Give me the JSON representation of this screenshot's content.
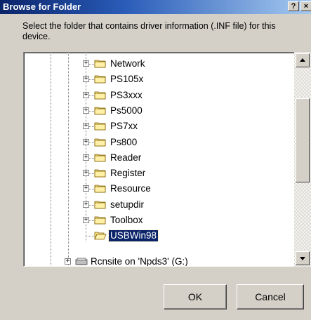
{
  "dialog": {
    "title": "Browse for Folder",
    "help_glyph": "?",
    "close_glyph": "×",
    "prompt": "Select the folder that contains driver information (.INF file) for this device."
  },
  "tree": {
    "items": [
      {
        "label": "Network",
        "expander": "+",
        "selected": false
      },
      {
        "label": "PS105x",
        "expander": "+",
        "selected": false
      },
      {
        "label": "PS3xxx",
        "expander": "+",
        "selected": false
      },
      {
        "label": "Ps5000",
        "expander": "+",
        "selected": false
      },
      {
        "label": "PS7xx",
        "expander": "+",
        "selected": false
      },
      {
        "label": "Ps800",
        "expander": "+",
        "selected": false
      },
      {
        "label": "Reader",
        "expander": "+",
        "selected": false
      },
      {
        "label": "Register",
        "expander": "+",
        "selected": false
      },
      {
        "label": "Resource",
        "expander": "+",
        "selected": false
      },
      {
        "label": "setupdir",
        "expander": "+",
        "selected": false
      },
      {
        "label": "Toolbox",
        "expander": "+",
        "selected": false
      },
      {
        "label": "USBWin98",
        "expander": "",
        "selected": true
      }
    ],
    "drive": {
      "label": "Rcnsite on 'Npds3' (G:)",
      "expander": "+"
    }
  },
  "buttons": {
    "ok": "OK",
    "cancel": "Cancel"
  },
  "colors": {
    "titlebar": "#0a246a",
    "selection": "#0a246a",
    "face": "#d4d0c8",
    "background": "#f7e6a8"
  }
}
